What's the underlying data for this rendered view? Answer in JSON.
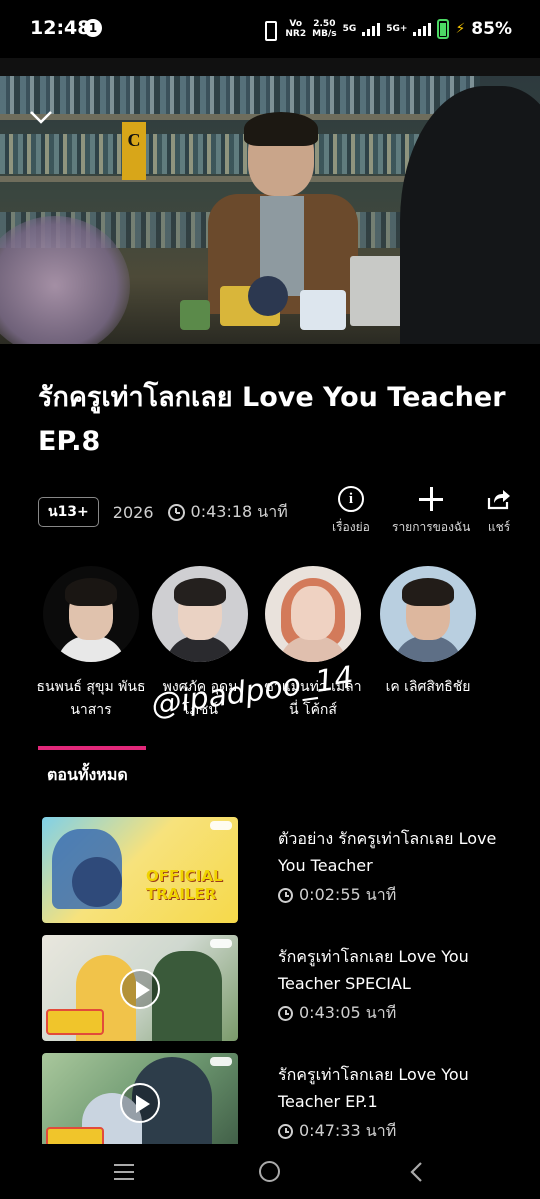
{
  "status_bar": {
    "time": "12:48",
    "notification_count": "1",
    "network_top": "Vo",
    "network_bottom": "NR2",
    "speed_top": "2.50",
    "speed_bottom": "MB/s",
    "sim1": "5G",
    "sim2": "5G+",
    "battery": "85%",
    "battery_color": "#4cd964"
  },
  "video": {
    "collapse_icon": "chevron-down-icon"
  },
  "show": {
    "title": "รักครูเท่าโลกเลย Love You Teacher EP.8",
    "rating": "น13+",
    "year": "2026",
    "duration": "0:43:18 นาที"
  },
  "actions": {
    "info_label": "เรื่องย่อ",
    "mylist_label": "รายการของฉัน",
    "share_label": "แชร์"
  },
  "cast": [
    {
      "name": "ธนพนธ์ สุขุม พันธนาสาร"
    },
    {
      "name": "พงศภัค อุดม โภชน์"
    },
    {
      "name": "ซาแมนท่า เมลา นี่ โค้กส์"
    },
    {
      "name": "เค เลิศสิทธิชัย"
    }
  ],
  "tabs": {
    "active": "ตอนทั้งหมด",
    "accent_color": "#e2287a"
  },
  "watermark": "@ipadpoo_14",
  "episodes": [
    {
      "title": "ตัวอย่าง รักครูเท่าโลกเลย Love You Teacher",
      "duration": "0:02:55 นาที",
      "thumb_text": "OFFICIAL TRAILER"
    },
    {
      "title": "รักครูเท่าโลกเลย Love You Teacher SPECIAL",
      "duration": "0:43:05 นาที"
    },
    {
      "title": "รักครูเท่าโลกเลย Love You Teacher EP.1",
      "duration": "0:47:33 นาที"
    }
  ]
}
